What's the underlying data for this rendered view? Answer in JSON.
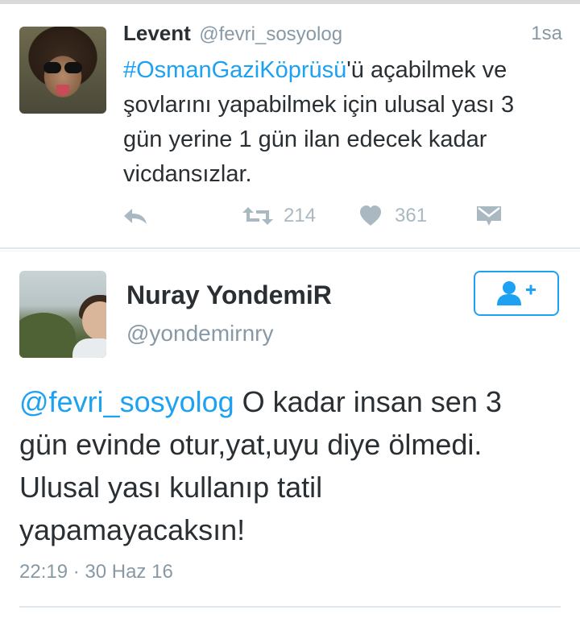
{
  "colors": {
    "accent": "#1da1f2",
    "text": "#292f33",
    "muted": "#8899a6",
    "icon": "#aab8c2",
    "divider": "#e1e8ed"
  },
  "tweet1": {
    "author_name": "Levent",
    "author_handle": "@fevri_sosyolog",
    "time": "1sa",
    "hashtag": "#OsmanGaziKöprüsü",
    "text_line1_rest": "'ü açabilmek ve",
    "text_line2": "şovlarını yapabilmek için ulusal yası 3",
    "text_line3": "gün yerine 1 gün ilan edecek kadar",
    "text_line4": "vicdansızlar.",
    "retweet_count": "214",
    "like_count": "361",
    "icons": {
      "avatar": "profile-photo",
      "reply": "reply-icon",
      "retweet": "retweet-icon",
      "like": "heart-icon",
      "dm": "direct-message-icon"
    }
  },
  "tweet2": {
    "author_name": "Nuray YondemiR",
    "author_handle": "@yondemirnry",
    "mention": "@fevri_sosyolog",
    "text_line1_rest": " O kadar insan sen 3",
    "text_line2": "gün evinde otur,yat,uyu diye ölmedi.",
    "text_line3": "Ulusal yası kullanıp tatil",
    "text_line4": "yapamayacaksın!",
    "timestamp": "22:19 · 30 Haz 16",
    "icons": {
      "follow": "follow-user-icon"
    }
  }
}
